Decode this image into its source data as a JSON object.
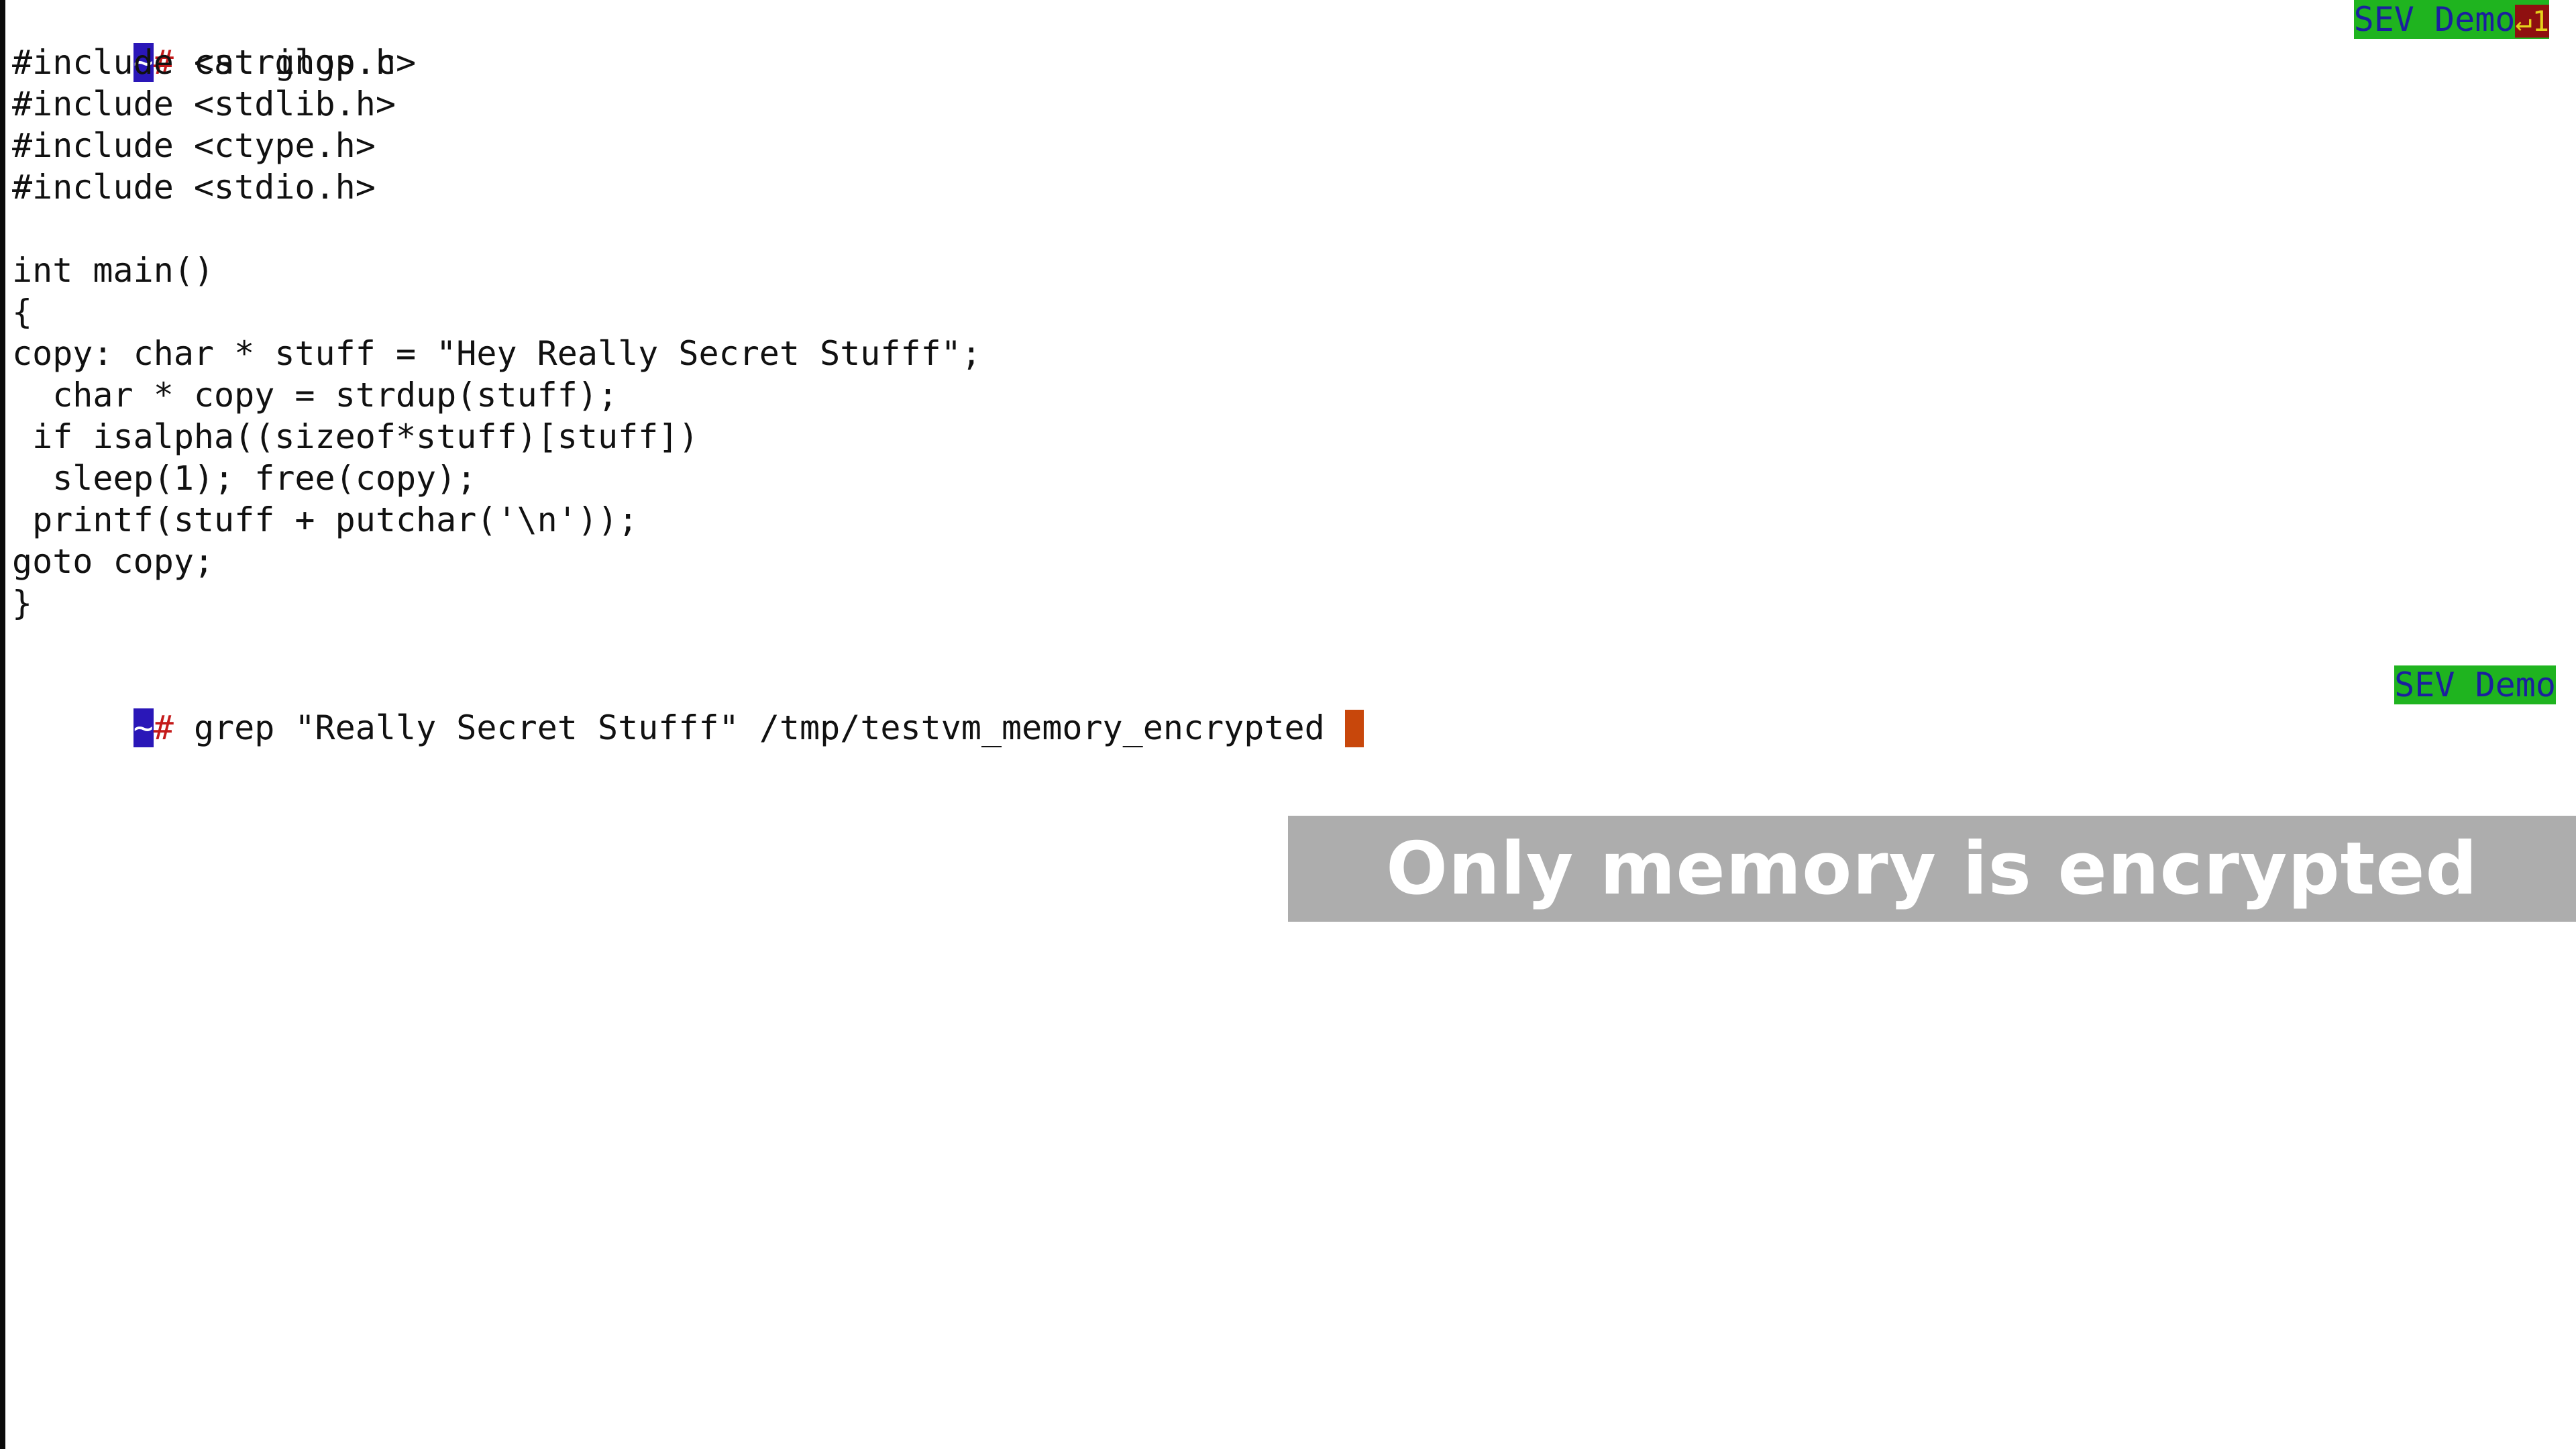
{
  "terminal": {
    "prompt_tilde": "~",
    "prompt_hash": "#",
    "command1": " cat glop.c",
    "code_lines": [
      "#include <strings.h>",
      "#include <stdlib.h>",
      "#include <ctype.h>",
      "#include <stdio.h>",
      "",
      "int main()",
      "{",
      "copy: char * stuff = \"Hey Really Secret Stufff\";",
      "  char * copy = strdup(stuff);",
      " if isalpha((sizeof*stuff)[stuff])",
      "  sleep(1); free(copy);",
      " printf(stuff + putchar('\\n'));",
      "goto copy;",
      "}",
      ""
    ],
    "command2": " grep \"Really Secret Stufff\" /tmp/testvm_memory_encrypted ",
    "badge_label": "SEV Demo",
    "badge_bell": "↵1"
  },
  "overlay": {
    "caption": "Only memory is encrypted"
  },
  "colors": {
    "prompt_bg": "#2a17b8",
    "prompt_hash": "#c41a1a",
    "badge_bg": "#1fb41f",
    "badge_text": "#1b1f9e",
    "cursor": "#c8470b",
    "overlay_bg": "#adadad"
  }
}
